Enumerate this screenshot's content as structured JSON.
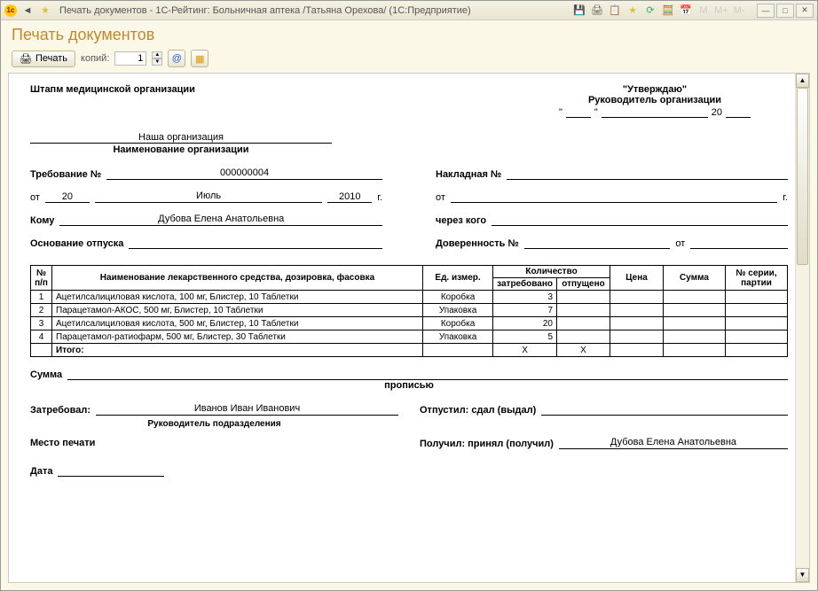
{
  "titlebar": {
    "title": "Печать документов - 1С-Рейтинг: Больничная аптека /Татьяна Орехова/  (1С:Предприятие)"
  },
  "header": {
    "title": "Печать документов",
    "print_label": "Печать",
    "copies_label": "копий:",
    "copies_value": "1"
  },
  "doc": {
    "stamp_label": "Штапм медицинской организации",
    "approve_title": "\"Утверждаю\"",
    "approve_sub": "Руководитель организации",
    "year_prefix": "20",
    "org_name": "Наша организация",
    "org_caption": "Наименование организации",
    "req_label": "Требование №",
    "req_no": "000000004",
    "from_label": "от",
    "from_day": "20",
    "from_month": "Июль",
    "from_year": "2010",
    "year_suffix": "г.",
    "kom_label": "Кому",
    "kom_value": "Дубова Елена Анатольевна",
    "osnov_label": "Основание отпуска",
    "osnov_value": "",
    "nakl_label": "Накладная №",
    "nakl_no": "",
    "from2_value": "",
    "through_label": "через кого",
    "through_value": "",
    "dover_label": "Доверенность №",
    "dover_no": "",
    "dover_from_label": "от",
    "dover_from": "",
    "table": {
      "h_num": "№ п/п",
      "h_name": "Наименование лекарственного средства, дозировка, фасовка",
      "h_unit": "Ед. измер.",
      "h_qty": "Количество",
      "h_req": "затребовано",
      "h_rel": "отпущено",
      "h_price": "Цена",
      "h_sum": "Сумма",
      "h_series": "№ серии, партии",
      "rows": [
        {
          "n": "1",
          "name": "Ацетилсалициловая кислота, 100 мг, Блистер, 10 Таблетки",
          "unit": "Коробка",
          "req": "3",
          "rel": "",
          "price": "",
          "sum": "",
          "series": ""
        },
        {
          "n": "2",
          "name": "Парацетамол-АКОС, 500 мг, Блистер, 10 Таблетки",
          "unit": "Упаковка",
          "req": "7",
          "rel": "",
          "price": "",
          "sum": "",
          "series": ""
        },
        {
          "n": "3",
          "name": "Ацетилсалициловая кислота, 500 мг, Блистер, 10 Таблетки",
          "unit": "Коробка",
          "req": "20",
          "rel": "",
          "price": "",
          "sum": "",
          "series": ""
        },
        {
          "n": "4",
          "name": "Парацетамол-ратиофарм, 500 мг, Блистер, 30 Таблетки",
          "unit": "Упаковка",
          "req": "5",
          "rel": "",
          "price": "",
          "sum": "",
          "series": ""
        }
      ],
      "total_label": "Итого:",
      "total_x1": "X",
      "total_x2": "X"
    },
    "sum_label": "Сумма",
    "propisyu": "прописью",
    "zatreb_label": "Затребовал:",
    "zatreb_value": "Иванов Иван Иванович",
    "zatreb_caption": "Руководитель подразделения",
    "otpust_label": "Отпустил: сдал (выдал)",
    "otpust_value": "",
    "mesto_label": "Место печати",
    "poluch_label": "Получил: принял (получил)",
    "poluch_value": "Дубова Елена Анатольевна",
    "date_label": "Дата"
  }
}
